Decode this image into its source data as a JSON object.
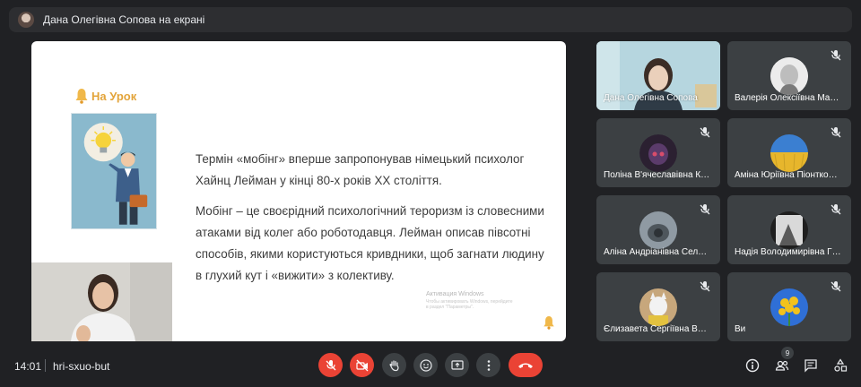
{
  "banner": {
    "text": "Дана Олегівна Сопова на екрані"
  },
  "slide": {
    "logo_text": "На Урок",
    "paragraph1": "Термін «мобінг» вперше запропонував німецький психолог Хайнц Лейман у кінці 80-х років XX століття.",
    "paragraph2": "Мобінг – це своєрідний психологічний тероризм із словесними атаками від колег або роботодавця. Лейман описав півсотні способів, якими користуються кривдники, щоб загнати людину в глухий кут і «вижити» з колективу.",
    "activation_title": "Активация Windows",
    "activation_sub": "Чтобы активировать Windows, перейдите в раздел \"Параметры\"."
  },
  "participants": [
    {
      "name": "Дана Олегівна Сопова",
      "muted": false,
      "presenter": true
    },
    {
      "name": "Валерія Олексіївна Ма…",
      "muted": true
    },
    {
      "name": "Поліна В'ячеславівна К…",
      "muted": true
    },
    {
      "name": "Аміна Юріївна Піонтко…",
      "muted": true
    },
    {
      "name": "Аліна Андріанівна Сел…",
      "muted": true
    },
    {
      "name": "Надія Володимирівна Г…",
      "muted": true
    },
    {
      "name": "Єлизавета Сергіївна В…",
      "muted": true
    },
    {
      "name": "Ви",
      "muted": true
    }
  ],
  "bottombar": {
    "time": "14:01",
    "meeting_code": "hri-sxuo-but",
    "people_count": "9"
  },
  "colors": {
    "background": "#202124",
    "tile": "#3c4043",
    "danger": "#ea4335",
    "accent_logo": "#e3a43a"
  }
}
